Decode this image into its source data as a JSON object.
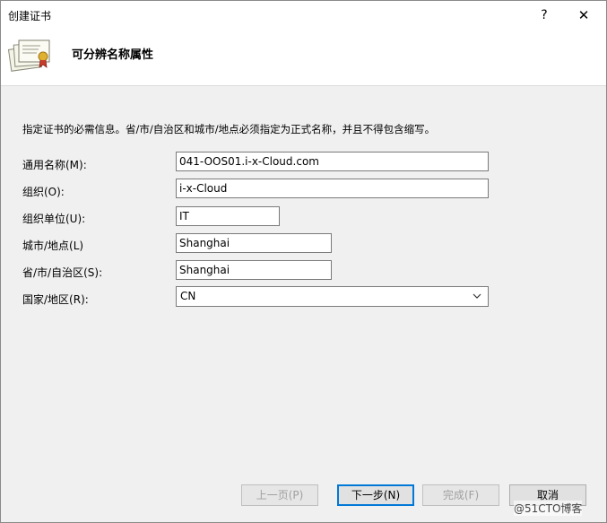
{
  "window": {
    "title": "创建证书",
    "help_glyph": "?",
    "close_glyph": "✕"
  },
  "header": {
    "title": "可分辨名称属性"
  },
  "instruction": "指定证书的必需信息。省/市/自治区和城市/地点必须指定为正式名称，并且不得包含缩写。",
  "fields": {
    "common_name": {
      "label": "通用名称(M):",
      "value": "041-OOS01.i-x-Cloud.com"
    },
    "organization": {
      "label": "组织(O):",
      "value": "i-x-Cloud"
    },
    "org_unit": {
      "label": "组织单位(U):",
      "value": "IT"
    },
    "city": {
      "label": "城市/地点(L)",
      "value": "Shanghai"
    },
    "state": {
      "label": "省/市/自治区(S):",
      "value": "Shanghai"
    },
    "country": {
      "label": "国家/地区(R):",
      "value": "CN"
    }
  },
  "buttons": {
    "previous": "上一页(P)",
    "next": "下一步(N)",
    "finish": "完成(F)",
    "cancel": "取消"
  },
  "watermark": "@51CTO博客",
  "colors": {
    "accent": "#0078d7",
    "window_bg": "#f0f0f0",
    "header_bg": "#ffffff"
  },
  "icons": {
    "header": "certificate-stack-icon",
    "dropdown": "chevron-down-icon"
  }
}
